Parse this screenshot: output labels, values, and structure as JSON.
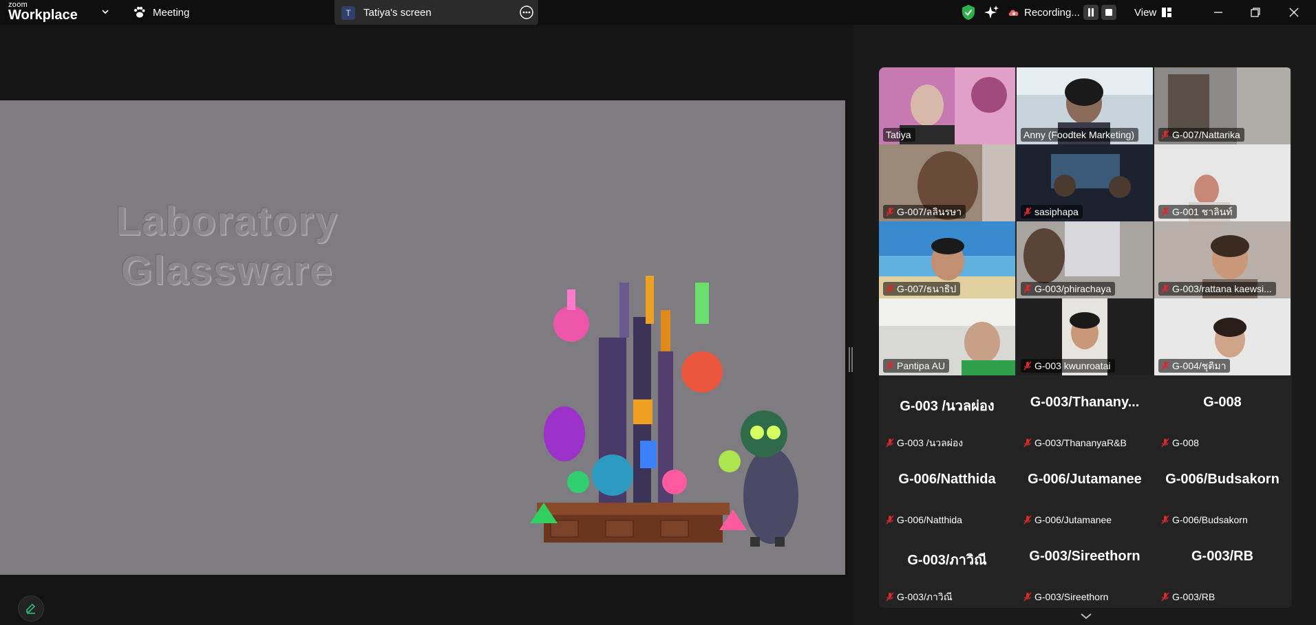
{
  "app": {
    "brand_top": "zoom",
    "brand_bottom": "Workplace",
    "meeting_label": "Meeting"
  },
  "share": {
    "avatar_letter": "T",
    "label": "Tatiya's screen"
  },
  "top_right": {
    "recording_label": "Recording...",
    "view_label": "View"
  },
  "slide": {
    "title_line1": "Laboratory",
    "title_line2": "Glassware"
  },
  "colors": {
    "active_speaker": "#23d18b",
    "mic_off": "#e02828",
    "slide_bg": "#7e7c80"
  },
  "participants": [
    {
      "name": "Tatiya",
      "muted": false,
      "video": true
    },
    {
      "name": "Anny (Foodtek Marketing)",
      "muted": false,
      "video": true,
      "active": true
    },
    {
      "name": "G-007/Nattarika",
      "muted": true,
      "video": true
    },
    {
      "name": "G-007/ลลินรษา",
      "muted": true,
      "video": true
    },
    {
      "name": "sasiphapa",
      "muted": true,
      "video": true
    },
    {
      "name": "G-001 ชาลินท์",
      "muted": true,
      "video": true
    },
    {
      "name": "G-007/ธนาธิป",
      "muted": true,
      "video": true
    },
    {
      "name": "G-003/phirachaya",
      "muted": true,
      "video": true
    },
    {
      "name": "G-003/rattana kaewsi...",
      "muted": true,
      "video": true
    },
    {
      "name": "Pantipa AU",
      "muted": true,
      "video": true
    },
    {
      "name": "G-003 kwunroatai",
      "muted": true,
      "video": true
    },
    {
      "name": "G-004/ชุติมา",
      "muted": true,
      "video": true
    },
    {
      "big": "G-003 /นวลผ่อง",
      "name": "G-003 /นวลผ่อง",
      "muted": true,
      "video": false
    },
    {
      "big": "G-003/Thanany...",
      "name": "G-003/ThananyaR&B",
      "muted": true,
      "video": false
    },
    {
      "big": "G-008",
      "name": "G-008",
      "muted": true,
      "video": false
    },
    {
      "big": "G-006/Natthida",
      "name": "G-006/Natthida",
      "muted": true,
      "video": false
    },
    {
      "big": "G-006/Jutamanee",
      "name": "G-006/Jutamanee",
      "muted": true,
      "video": false
    },
    {
      "big": "G-006/Budsakorn",
      "name": "G-006/Budsakorn",
      "muted": true,
      "video": false
    },
    {
      "big": "G-003/ภาวิณี",
      "name": "G-003/ภาวิณี",
      "muted": true,
      "video": false
    },
    {
      "big": "G-003/Sireethorn",
      "name": "G-003/Sireethorn",
      "muted": true,
      "video": false
    },
    {
      "big": "G-003/RB",
      "name": "G-003/RB",
      "muted": true,
      "video": false
    }
  ]
}
